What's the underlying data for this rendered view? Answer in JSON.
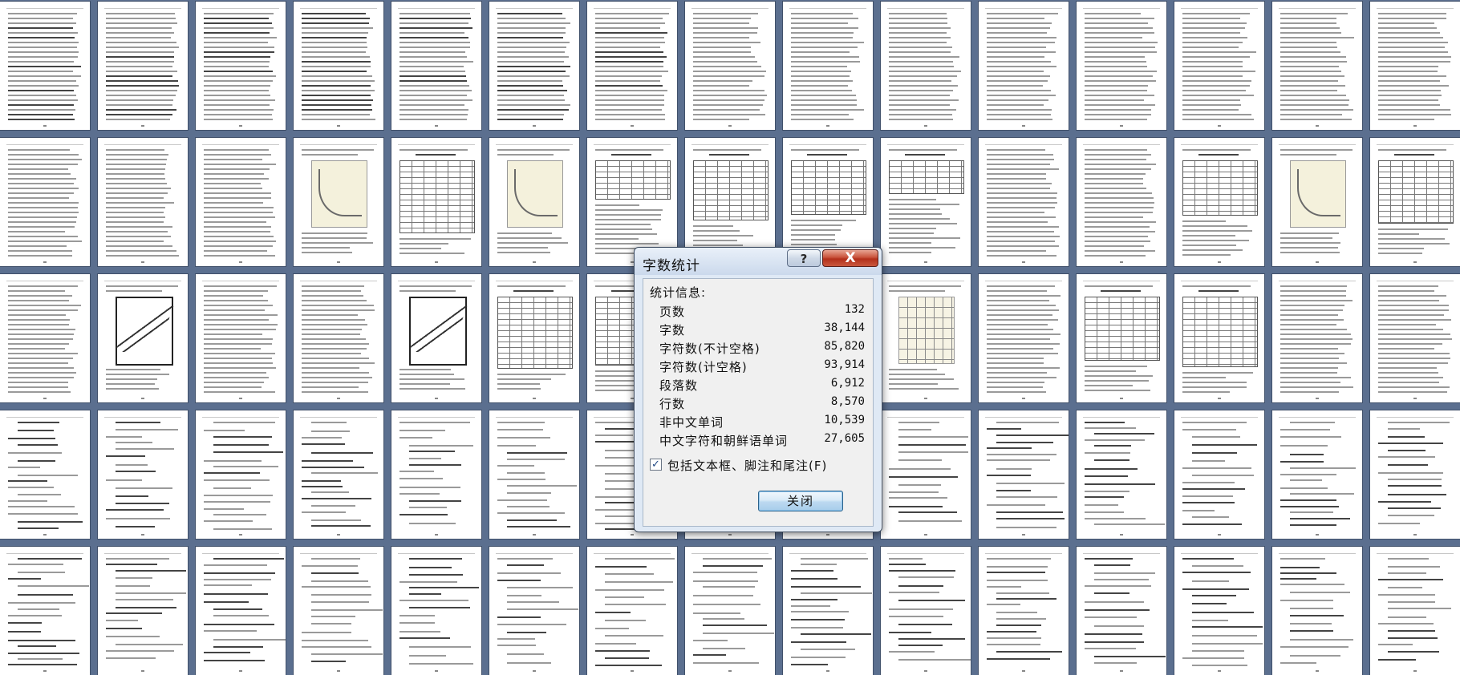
{
  "dialog": {
    "title": "字数统计",
    "help_label": "?",
    "close_x_label": "X",
    "section_label": "统计信息:",
    "stats": [
      {
        "label": "页数",
        "value": "132"
      },
      {
        "label": "字数",
        "value": "38,144"
      },
      {
        "label": "字符数(不计空格)",
        "value": "85,820"
      },
      {
        "label": "字符数(计空格)",
        "value": "93,914"
      },
      {
        "label": "段落数",
        "value": "6,912"
      },
      {
        "label": "行数",
        "value": "8,570"
      },
      {
        "label": "非中文单词",
        "value": "10,539"
      },
      {
        "label": "中文字符和朝鲜语单词",
        "value": "27,605"
      }
    ],
    "include_checkbox": {
      "checked_mark": "✓",
      "label": "包括文本框、脚注和尾注(F)"
    },
    "close_button_label": "关闭"
  },
  "colors": {
    "workspace_background": "#5b6f8f",
    "dialog_frame": "#dfe9f5",
    "close_x_button": "#c9533c",
    "default_button": "#bcd9f0"
  },
  "icons": [
    "help-icon",
    "close-icon",
    "checkmark-icon"
  ]
}
